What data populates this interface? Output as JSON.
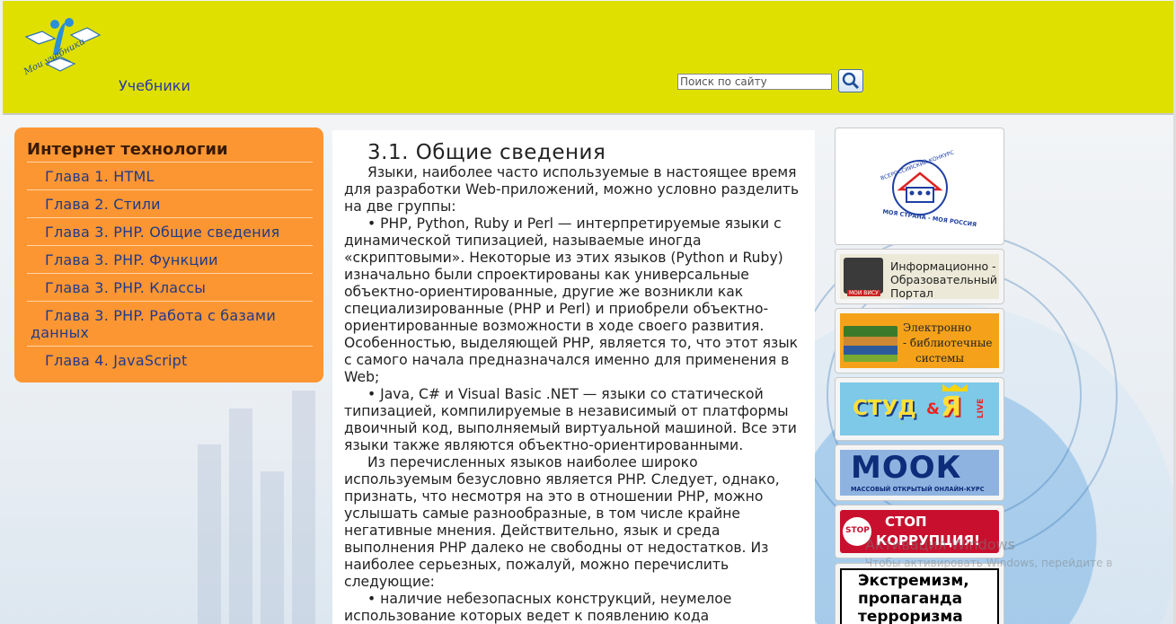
{
  "header": {
    "logo_text": "Мои учебники",
    "site_link": "Учебники",
    "search_placeholder": "Поиск по сайту",
    "search_button_icon": "magnifier-icon"
  },
  "menu": {
    "title": "Интернет технологии",
    "items": [
      {
        "label": "Глава 1. HTML"
      },
      {
        "label": "Глава 2. Стили"
      },
      {
        "label": "Глава 3. PHP. Общие сведения"
      },
      {
        "label": "Глава 3. PHP. Функции"
      },
      {
        "label": "Глава 3. PHP. Классы"
      },
      {
        "label": "Глава 3. PHP. Работа с базами данных"
      },
      {
        "label": "Глава 4. JavaScript"
      }
    ]
  },
  "article": {
    "title": "3.1. Общие сведения",
    "paragraphs": [
      "Языки, наиболее часто используемые в настоящее время для разработки Web-приложений, можно условно разделить на две группы:",
      "• PHP, Python, Ruby и Perl — интерпретируемые языки с динамической типизацией, называемые иногда «скриптовыми». Некоторые из этих языков (Python и Ruby) изначально были спроектированы как универсальные объектно-ориентированные, другие же возникли как специализированные (PHP и Perl) и приобрели объектно-ориентированные возможности в ходе своего развития. Особенностью, выделяющей PHP, является то, что этот язык с самого начала предназначался именно для применения в Web;",
      "• Java, C# и Visual Basic .NET — языки со статической типизацией, компилируемые в независимый от платформы двоичный код, выполняемый виртуальной машиной. Все эти языки также являются объектно-ориентированными.",
      "Из перечисленных языков наиболее широко используемым безусловно является PHP. Следует, однако, признать, что несмотря на это в отношении PHP, можно услышать самые разнообразные, в том числе крайне негативные мнения. Действительно, язык и среда выполнения PHP далеко не свободны от недостатков. Из наиболее серьезных, пожалуй, можно перечислить следующие:",
      "• наличие небезопасных конструкций, неумелое использование которых ведет к появлению кода"
    ]
  },
  "banners": {
    "contest": {
      "top": "ВСЕРОССИЙСКИЙ КОНКУРС",
      "bottom": "МОЯ СТРАНА - МОЯ РОССИЯ"
    },
    "portal": {
      "line1": "Информационно -",
      "line2": "Образовательный",
      "line3": "Портал",
      "badge": "МОИ ВИСУ"
    },
    "library": {
      "line1": "Электронно",
      "line2": "- библиотечные",
      "line3": "системы"
    },
    "stud": {
      "text1": "СТУД",
      "amp": "&",
      "text2": "Я",
      "live": "LIVE"
    },
    "mook": {
      "title": "МООК",
      "subtitle": "МАССОВЫЙ ОТКРЫТЫЙ ОНЛАЙН-КУРС"
    },
    "corruption": {
      "line1": "СТОП",
      "line2": "КОРРУПЦИЯ!",
      "sign": "STOP"
    },
    "extremism": {
      "line1": "Экстремизм,",
      "line2": "пропаганда",
      "line3": "терроризма"
    }
  },
  "watermark": {
    "line1": "Активация Windows",
    "line2": "Чтобы активировать Windows, перейдите в"
  },
  "colors": {
    "header_bg": "#dfe000",
    "menu_bg": "#fc9632",
    "menu_link": "#203a8a",
    "site_link": "#2a3aa8"
  }
}
